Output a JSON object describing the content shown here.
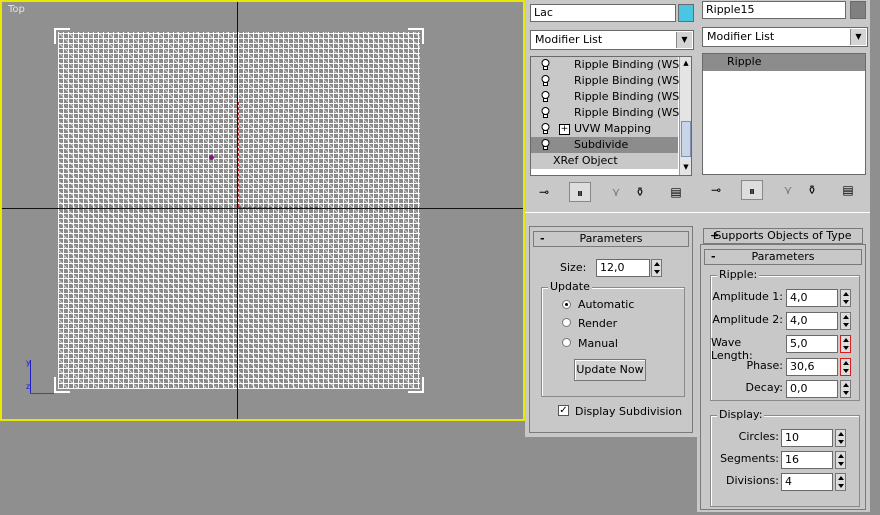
{
  "viewport": {
    "label": "Top"
  },
  "left_panel": {
    "object_name": "Lac",
    "object_color": "#4cc4e4",
    "modifier_list": "Modifier List",
    "stack": [
      {
        "label": "Ripple Binding (WSM",
        "expand": false,
        "selected": false
      },
      {
        "label": "Ripple Binding (WSM",
        "expand": false,
        "selected": false
      },
      {
        "label": "Ripple Binding (WSM",
        "expand": false,
        "selected": false
      },
      {
        "label": "Ripple Binding (WSM",
        "expand": false,
        "selected": false
      },
      {
        "label": "UVW Mapping",
        "expand": true,
        "selected": false
      },
      {
        "label": "Subdivide",
        "expand": false,
        "selected": true
      },
      {
        "label": "XRef Object",
        "expand": false,
        "selected": false
      }
    ],
    "parameters": {
      "title": "Parameters",
      "size_label": "Size:",
      "size_value": "12,0",
      "update_label": "Update",
      "automatic": "Automatic",
      "render": "Render",
      "manual": "Manual",
      "update_now": "Update Now",
      "display_subdivision": "Display Subdivision"
    }
  },
  "right_panel": {
    "object_name": "Ripple15",
    "object_color": "#808080",
    "modifier_list": "Modifier List",
    "stack": [
      {
        "label": "Ripple",
        "selected": true
      }
    ],
    "supports": "Supports Objects of Type",
    "parameters_title": "Parameters",
    "ripple_group": "Ripple:",
    "amplitude1_label": "Amplitude 1:",
    "amplitude1": "4,0",
    "amplitude2_label": "Amplitude 2:",
    "amplitude2": "4,0",
    "wavelength_label": "Wave Length:",
    "wavelength": "5,0",
    "phase_label": "Phase:",
    "phase": "30,6",
    "decay_label": "Decay:",
    "decay": "0,0",
    "display_group": "Display:",
    "circles_label": "Circles:",
    "circles": "10",
    "segments_label": "Segments:",
    "segments": "16",
    "divisions_label": "Divisions:",
    "divisions": "4"
  }
}
